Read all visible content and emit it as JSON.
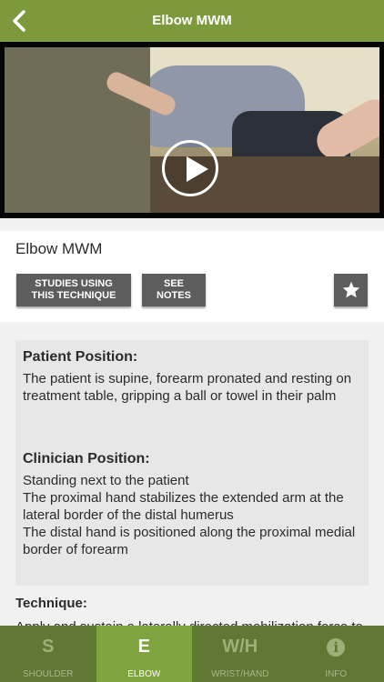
{
  "nav": {
    "title": "Elbow MWM",
    "back_icon": "chevron-left-icon"
  },
  "video": {
    "play_icon": "play-icon"
  },
  "header": {
    "title": "Elbow MWM",
    "studies_button": "STUDIES USING THIS TECHNIQUE",
    "notes_button": "SEE NOTES",
    "favorite_icon": "star-icon"
  },
  "content": {
    "patient_heading": "Patient Position:",
    "patient_text": "The patient is supine, forearm pronated and resting on treatment table, gripping a ball or towel in their palm",
    "clinician_heading": "Clinician Position:",
    "clinician_lines": [
      "Standing next to the patient",
      "The proximal hand stabilizes the extended arm at the lateral border of the distal humerus",
      "The distal hand is positioned along the proximal medial border of forearm"
    ],
    "technique_heading": "Technique:",
    "technique_text": "Apply and sustain a laterally directed mobilization force to"
  },
  "tabs": [
    {
      "icon": "S",
      "label": "SHOULDER",
      "active": false
    },
    {
      "icon": "E",
      "label": "ELBOW",
      "active": true
    },
    {
      "icon": "W/H",
      "label": "WRIST/HAND",
      "active": false
    },
    {
      "icon": "i",
      "label": "INFO",
      "active": false
    }
  ],
  "colors": {
    "brand_green": "#7c9a3c",
    "tab_bar": "#5f7834",
    "tab_active": "#7fa33e",
    "button_gray": "#5d5d5d"
  }
}
